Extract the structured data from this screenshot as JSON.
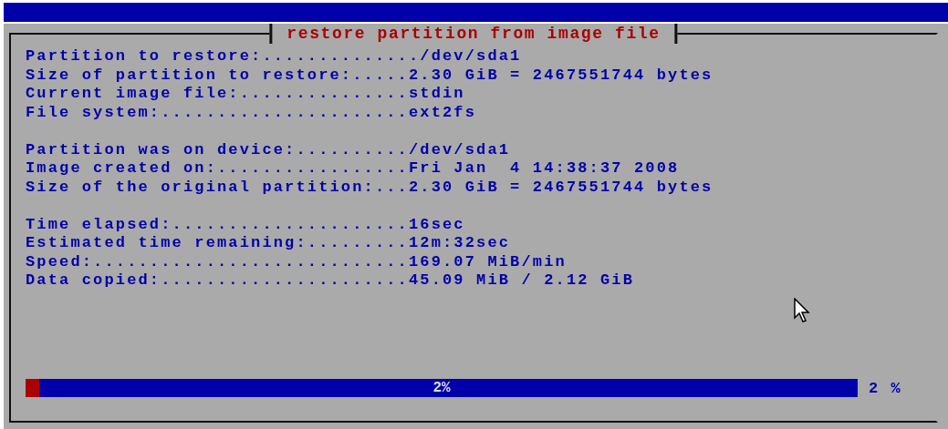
{
  "dialog": {
    "title": "restore partition from image file",
    "sections": [
      {
        "lines": [
          "Partition to restore:............../dev/sda1",
          "Size of partition to restore:.....2.30 GiB = 2467551744 bytes",
          "Current image file:...............stdin",
          "File system:......................ext2fs"
        ]
      },
      {
        "lines": [
          "Partition was on device:........../dev/sda1",
          "Image created on:.................Fri Jan  4 14:38:37 2008",
          "Size of the original partition:...2.30 GiB = 2467551744 bytes"
        ]
      },
      {
        "lines": [
          "Time elapsed:.....................16sec",
          "Estimated time remaining:.........12m:32sec",
          "Speed:............................169.07 MiB/min",
          "Data copied:......................45.09 MiB / 2.12 GiB"
        ]
      }
    ],
    "progress": {
      "level": 0.016,
      "bar_label": "2%",
      "reading": "2 %"
    }
  }
}
